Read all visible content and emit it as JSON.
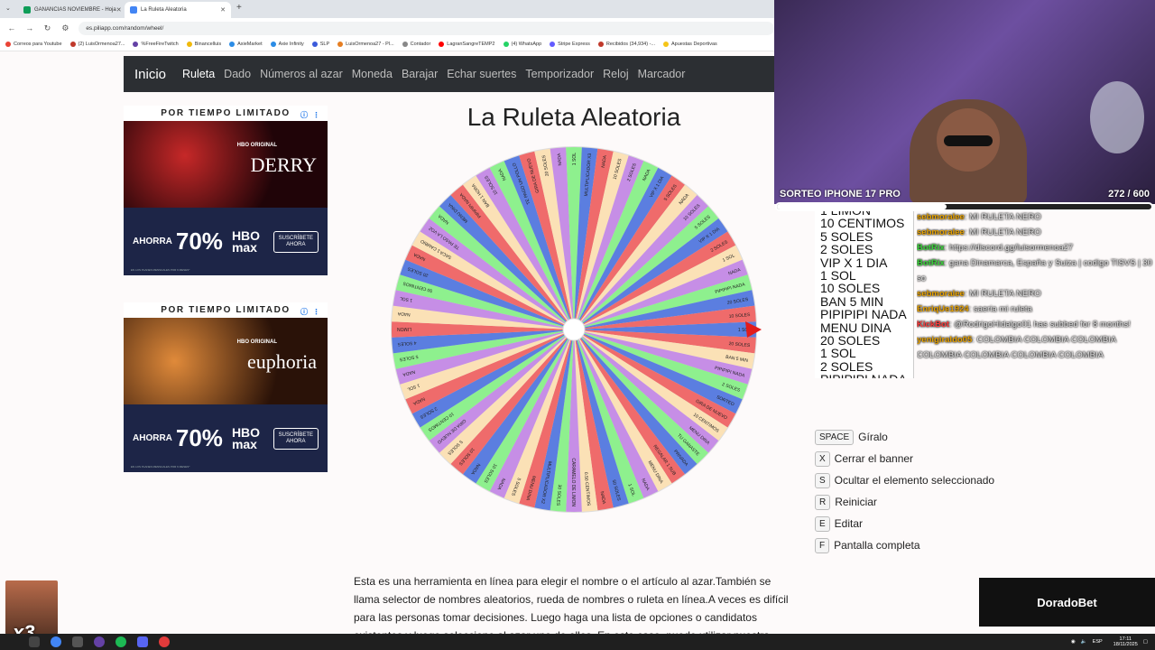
{
  "browser": {
    "tabs": [
      {
        "label": "GANANCIAS NOVIEMBRE - Hoja",
        "color": "#0f9d58"
      },
      {
        "label": "La Ruleta Aleatoria",
        "color": "#4285f4"
      }
    ],
    "url": "es.piliapp.com/random/wheel/",
    "bookmarks": [
      "Correos para Youtube",
      "(2) LuisOrmenoa27...",
      "%FreeFireTwitch",
      "Binancelluis",
      "AxieMarket",
      "Axie Infinity",
      "SLP",
      "LuisOrmenoa27 - Pl...",
      "Contador",
      "LagranSangreTEMP2",
      "(4) WhatsApp",
      "Stripe Express",
      "Recibidos (34,934) -...",
      "Apuestas Deportivas"
    ]
  },
  "site": {
    "brand": "Inicio",
    "nav": [
      "Ruleta",
      "Dado",
      "Números al azar",
      "Moneda",
      "Barajar",
      "Echar suertes",
      "Temporizador",
      "Reloj",
      "Marcador"
    ],
    "title": "La Ruleta Aleatoria",
    "intro": "Esta es una herramienta en línea para elegir el nombre o el artículo al azar.También se llama selector de nombres aleatorios, rueda de nombres o ruleta en línea.A veces es difícil para las personas tomar decisiones. Luego haga una lista de opciones o candidatos existentes y luego seleccione al azar uno de ellos. En este caso, puede utilizar nuestra herramienta para"
  },
  "ads": [
    {
      "top": "POR TIEMPO LIMITADO",
      "show": "DERRY",
      "hbo": "HBO ORIGINAL",
      "save": "AHORRA",
      "pct": "70%",
      "brand": "HBO max",
      "cta": "SUSCRÍBETE AHORA",
      "fine": "EN LOS PLANES MENSUALES POR 6 MESES*",
      "bg": "#3b0d10"
    },
    {
      "top": "POR TIEMPO LIMITADO",
      "show": "euphoria",
      "hbo": "HBO ORIGINAL",
      "save": "AHORRA",
      "pct": "70%",
      "brand": "HBO max",
      "cta": "SUSCRÍBETE AHORA",
      "fine": "EN LOS PLANES MENSUALES POR 6 MESES*",
      "bg": "#4a2210"
    }
  ],
  "wheel": {
    "colors": [
      "#5b7ee0",
      "#ef6b6b",
      "#fbe1b6",
      "#c68ee6",
      "#8ef08e"
    ],
    "segments": [
      "1 SOL",
      "20 SOLES",
      "BAN 5 MIN",
      "PIPIPIPI NADA",
      "2 SOLES",
      "SORTEO",
      "GIRA DE NUEVO",
      "10 CENTIMOS",
      "MENU DINA",
      "TU GANASTE",
      "PRIVADA",
      "REGALAR 1 SUB",
      "MENU DINA",
      "NADA",
      "1 SOL",
      "50 SOLES",
      "NADA",
      "0.50 CENTIMOS",
      "CARAMELO DE LIMON",
      "30 SOLES",
      "MULTIPLICADOR X2",
      "MENU DINA",
      "5 SOLES",
      "NADA",
      "10 SOLES",
      "NADA",
      "10 SOLES",
      "5 SOLES",
      "GIRA DE NUEVO",
      "10 CENTIMOS",
      "2 SOLES",
      "NADA",
      "1 SOL",
      "NADA",
      "5 SOLES",
      "4 SOLES",
      "LIMON",
      "NADA",
      "1 SOL",
      "50 CENTIMOS",
      "20 SOLES",
      "NADA",
      "SACA 1 CAMBIO",
      "TE PASO LA VOZ",
      "NADA",
      "MENU DINA",
      "PIPIPIPI NADA",
      "BAN 1 HORA",
      "10 SOLES",
      "NADA",
      "TE PAGO UN POLLO",
      "GIRA DE NUEVO",
      "20 SOLES",
      "NADA",
      "1 SOL",
      "MULTIPLICADOR X3",
      "NADA",
      "10 SOLES",
      "2 SOLES",
      "NADA",
      "VIP X 1 DIA",
      "5 SOLES",
      "NADA",
      "10 SOLES",
      "5 SOLES",
      "VIP X 1 DIA",
      "2 SOLES",
      "1 SOL",
      "NADA",
      "PIPIPIPI NADA",
      "20 SOLES",
      "10 SOLES"
    ]
  },
  "stream": {
    "title": "SORTEO IPHONE 17 PRO",
    "count": "272 / 600",
    "progress": 0.453,
    "options": [
      "1 LIMON",
      "10 CENTIMOS",
      "5 SOLES",
      "2 SOLES",
      "VIP X 1 DIA",
      "1 SOL",
      "10 SOLES",
      "BAN 5 MIN",
      "PIPIPIPI NADA",
      "MENU DINA",
      "20 SOLES",
      "1 SOL",
      "2 SOLES",
      "PIPIPIPI NADA"
    ],
    "chat": [
      {
        "user": "sebmoralee",
        "color": "#e8a200",
        "msg": ": MI RULETA NERO"
      },
      {
        "user": "sebmoralee",
        "color": "#e8a200",
        "msg": ": MI RULETA NERO"
      },
      {
        "user": "BotRix",
        "color": "#3cd63c",
        "msg": ": https://discord.gg/luisormenoa27"
      },
      {
        "user": "BotRix",
        "color": "#3cd63c",
        "msg": ": gana Dinamarca, España y Suiza | codigo TISVS | 30 so"
      },
      {
        "user": "sebmoralee",
        "color": "#e8a200",
        "msg": ": MI RULETA NERO"
      },
      {
        "user": "EnriqUe1924",
        "color": "#e8a200",
        "msg": ": saeria mi ruleta"
      },
      {
        "user": "KickBot",
        "color": "#ff3b3b",
        "msg": ": @RodrigoHidalgo01 has subbed for 8 months!"
      },
      {
        "user": "yenigiraldo05",
        "color": "#e8a200",
        "msg": ": COLOMBIA COLOMBIA COLOMBIA COLOMBIA COLOMBIA COLOMBIA COLOMBIA"
      }
    ],
    "sponsor": "DoradoBet",
    "emote_mult": "x3"
  },
  "shortcuts": [
    {
      "key": "SPACE",
      "label": "Gíralo"
    },
    {
      "key": "X",
      "label": "Cerrar el banner"
    },
    {
      "key": "S",
      "label": "Ocultar el elemento seleccionado"
    },
    {
      "key": "R",
      "label": "Reiniciar"
    },
    {
      "key": "E",
      "label": "Editar"
    },
    {
      "key": "F",
      "label": "Pantalla completa"
    }
  ],
  "taskbar": {
    "lang": "ESP",
    "time": "17:11",
    "date": "18/11/2025"
  }
}
